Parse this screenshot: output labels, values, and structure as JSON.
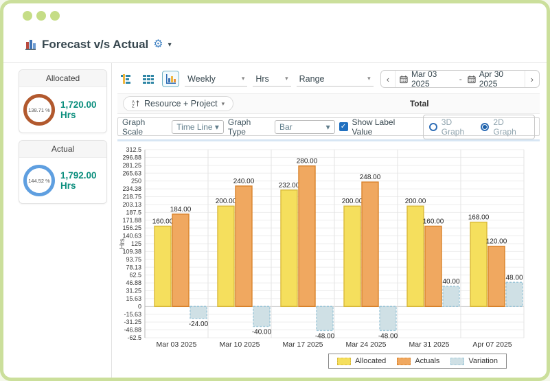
{
  "window": {
    "title": "Forecast v/s Actual"
  },
  "header": {
    "gear_icon": "⚙",
    "caret": "▾"
  },
  "sidebar": {
    "cards": [
      {
        "label": "Allocated",
        "percent": "138.71 %",
        "value": "1,720.00 Hrs",
        "ring_color": "#b2592e"
      },
      {
        "label": "Actual",
        "percent": "144.52 %",
        "value": "1,792.00 Hrs",
        "ring_color": "#5f9fe0"
      }
    ]
  },
  "toolbar": {
    "view_icons": [
      "gantt-view-icon",
      "grid-view-icon",
      "bar-chart-view-icon"
    ],
    "period_select": "Weekly",
    "unit_select": "Hrs",
    "range_select": "Range",
    "select_caret": "▾",
    "prev": "‹",
    "next": "›",
    "date_start": "Mar 03 2025",
    "date_separator": "-",
    "date_end": "Apr 30 2025"
  },
  "filter_row": {
    "group_by": "Resource + Project",
    "column_total": "Total"
  },
  "options": {
    "graph_scale_label": "Graph Scale",
    "graph_scale_value": "Time Line",
    "graph_type_label": "Graph Type",
    "graph_type_value": "Bar",
    "checkbox_glyph": "✓",
    "show_label_value_label": "Show Label Value",
    "show_label_value_checked": true,
    "graph_3d_label": "3D Graph",
    "graph_2d_label": "2D Graph",
    "selected_dimension": "2D Graph"
  },
  "chart_data": {
    "type": "bar",
    "title": "",
    "ylabel": "Hrs",
    "categories": [
      "Mar 03 2025",
      "Mar 10 2025",
      "Mar 17 2025",
      "Mar 24 2025",
      "Mar 31 2025",
      "Apr 07 2025"
    ],
    "series": [
      {
        "name": "Allocated",
        "color": "#f5df5d",
        "border": "#d9b93a",
        "dash": false,
        "values": [
          160,
          200,
          232,
          200,
          200,
          168
        ]
      },
      {
        "name": "Actuals",
        "color": "#f0a860",
        "border": "#d9822b",
        "dash": false,
        "values": [
          184,
          240,
          280,
          248,
          160,
          120
        ]
      },
      {
        "name": "Variation",
        "color": "#cfe0e5",
        "border": "#9ec7d8",
        "dash": true,
        "values": [
          -24,
          -40,
          -48,
          -48,
          40,
          48
        ]
      }
    ],
    "ylim": [
      -62.5,
      312.5
    ],
    "ytick_step": 15.625,
    "ytick_labels": [
      "312.5",
      "296.88",
      "281.25",
      "265.63",
      "250",
      "234.38",
      "218.75",
      "203.13",
      "187.5",
      "171.88",
      "156.25",
      "140.63",
      "125",
      "109.38",
      "93.75",
      "78.13",
      "62.5",
      "46.88",
      "31.25",
      "15.63",
      "0",
      "-15.63",
      "-31.25",
      "-46.88",
      "-62.5"
    ],
    "grid": true,
    "legend_position": "bottom-right",
    "value_label_decimals": 2
  }
}
